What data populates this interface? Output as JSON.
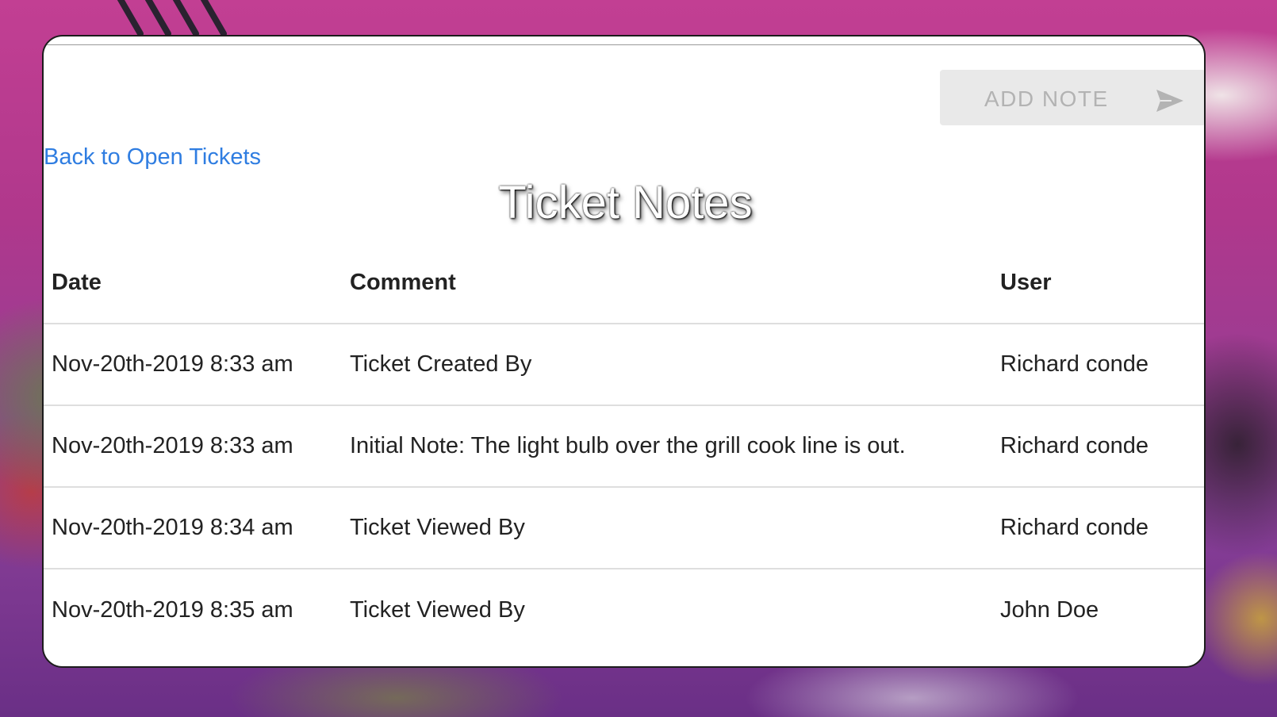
{
  "toolbar": {
    "add_note_label": "ADD NOTE",
    "send_icon": "send-arrow-icon"
  },
  "nav": {
    "back_label": "Back to Open Tickets"
  },
  "page": {
    "title": "Ticket Notes"
  },
  "notes_table": {
    "columns": [
      "Date",
      "Comment",
      "User"
    ],
    "rows": [
      {
        "date": "Nov-20th-2019 8:33 am",
        "comment": "Ticket Created By",
        "user": "Richard conde"
      },
      {
        "date": "Nov-20th-2019 8:33 am",
        "comment": "Initial Note: The light bulb over the grill cook line is out.",
        "user": "Richard conde"
      },
      {
        "date": "Nov-20th-2019 8:34 am",
        "comment": "Ticket Viewed By",
        "user": "Richard conde"
      },
      {
        "date": "Nov-20th-2019 8:35 am",
        "comment": "Ticket Viewed By",
        "user": "John Doe"
      }
    ]
  },
  "colors": {
    "link": "#2f7de1",
    "button_bg": "#e9e9e9",
    "button_text": "#b3b3b3",
    "background_accent": "#c23f93"
  }
}
